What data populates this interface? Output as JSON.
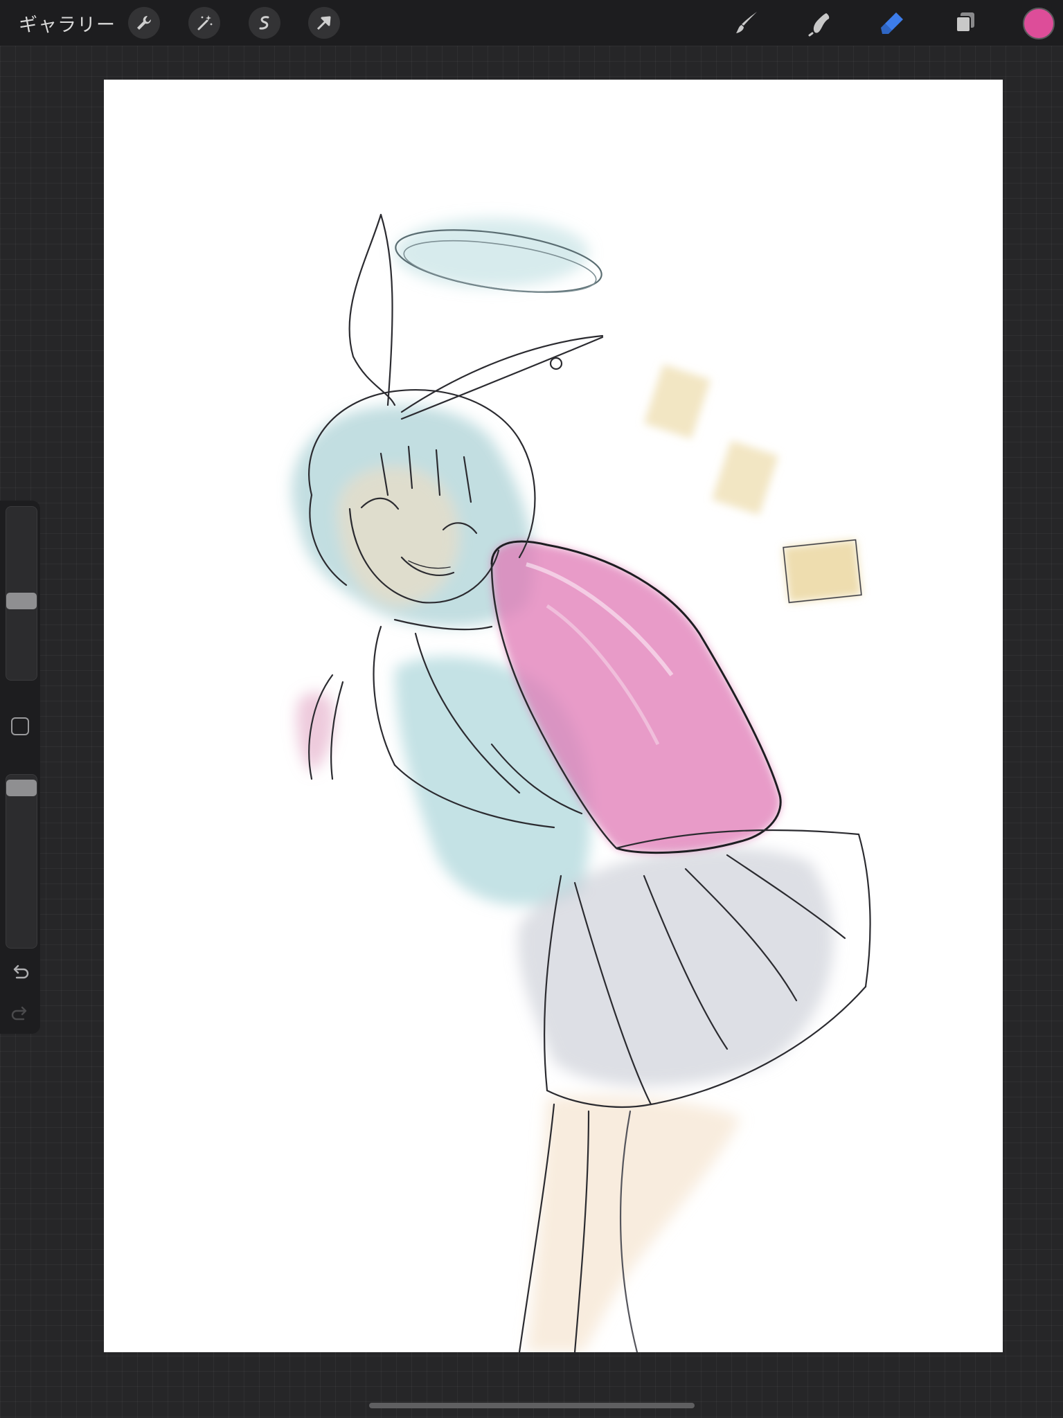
{
  "topbar": {
    "gallery_label": "ギャラリー",
    "left_tools": [
      "wrench-icon",
      "magic-wand-icon",
      "selection-icon",
      "transform-arrow-icon"
    ],
    "right_tools": [
      "brush-icon",
      "smudge-icon",
      "eraser-icon",
      "layers-icon"
    ],
    "active_tool": "eraser",
    "current_color": "#dd4d99"
  },
  "sidebar": {
    "brush_size_level": 0.45,
    "opacity_level": 0.03
  },
  "colors": {
    "accent_blue": "#3d7dea",
    "ui_background": "#1d1d1f",
    "canvas_background": "#ffffff"
  }
}
